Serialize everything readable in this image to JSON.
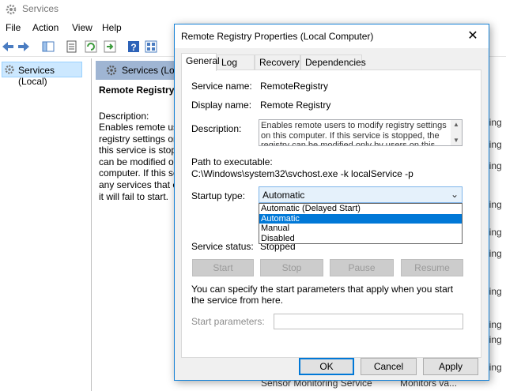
{
  "services_window": {
    "title": "Services",
    "menu": [
      "File",
      "Action",
      "View",
      "Help"
    ],
    "tree_item": "Services (Local)",
    "pane_header": "Services (Loc",
    "selected_service": "Remote Registry",
    "description_label": "Description:",
    "description_text": "Enables remote use\nregistry settings on\nthis service is stopp\ncan be modified or\ncomputer. If this se\nany services that ex\nit will fail to start.",
    "right_fragments": [
      "ning",
      "ning",
      "ning",
      "ning",
      "ning",
      "ning",
      "ning",
      "ning",
      "ning",
      "ning"
    ],
    "bottom_row_name": "Sensor Monitoring Service",
    "bottom_row_desc": "Monitors va..."
  },
  "dialog": {
    "title": "Remote Registry Properties (Local Computer)",
    "close": "✕",
    "tabs": [
      "General",
      "Log On",
      "Recovery",
      "Dependencies"
    ],
    "service_name_label": "Service name:",
    "service_name": "RemoteRegistry",
    "display_name_label": "Display name:",
    "display_name": "Remote Registry",
    "description_label": "Description:",
    "description": "Enables remote users to modify registry settings on this computer. If this service is stopped, the registry can be modified only by users on this computer. If",
    "path_label": "Path to executable:",
    "path": "C:\\Windows\\system32\\svchost.exe -k localService -p",
    "startup_label": "Startup type:",
    "startup_value": "Automatic",
    "startup_options": [
      "Automatic (Delayed Start)",
      "Automatic",
      "Manual",
      "Disabled"
    ],
    "startup_selected_index": 1,
    "status_label": "Service status:",
    "status_value": "Stopped",
    "buttons": {
      "start": "Start",
      "stop": "Stop",
      "pause": "Pause",
      "resume": "Resume"
    },
    "hint": "You can specify the start parameters that apply when you start the service from here.",
    "params_label": "Start parameters:",
    "params_value": "",
    "ok": "OK",
    "cancel": "Cancel",
    "apply": "Apply"
  }
}
